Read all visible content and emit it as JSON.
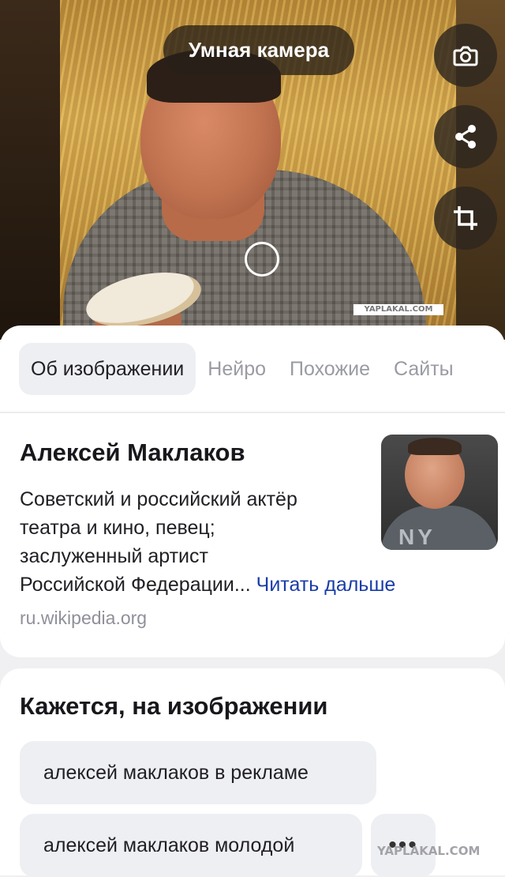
{
  "camera": {
    "title": "Умная камера",
    "image_watermark": "YAPLAKAL.COM"
  },
  "tabs": [
    {
      "label": "Об изображении",
      "active": true
    },
    {
      "label": "Нейро",
      "active": false
    },
    {
      "label": "Похожие",
      "active": false
    },
    {
      "label": "Сайты",
      "active": false
    }
  ],
  "entity": {
    "name": "Алексей Маклаков",
    "description_lines": [
      "Советский и российский актёр",
      "театра и кино, певец;",
      "заслуженный артист",
      "Российской Федерации..."
    ],
    "read_more": "Читать дальше",
    "source": "ru.wikipedia.org",
    "thumb_text": "NY"
  },
  "related": {
    "title": "Кажется, на изображении",
    "chips": [
      "алексей маклаков в рекламе",
      "алексей маклаков молодой"
    ],
    "more_label": "•••"
  },
  "site_watermark": "YAPLAKAL.COM",
  "colors": {
    "link": "#1a3caa",
    "chip_bg": "#eeeff2",
    "button_bg": "#2d261e"
  }
}
